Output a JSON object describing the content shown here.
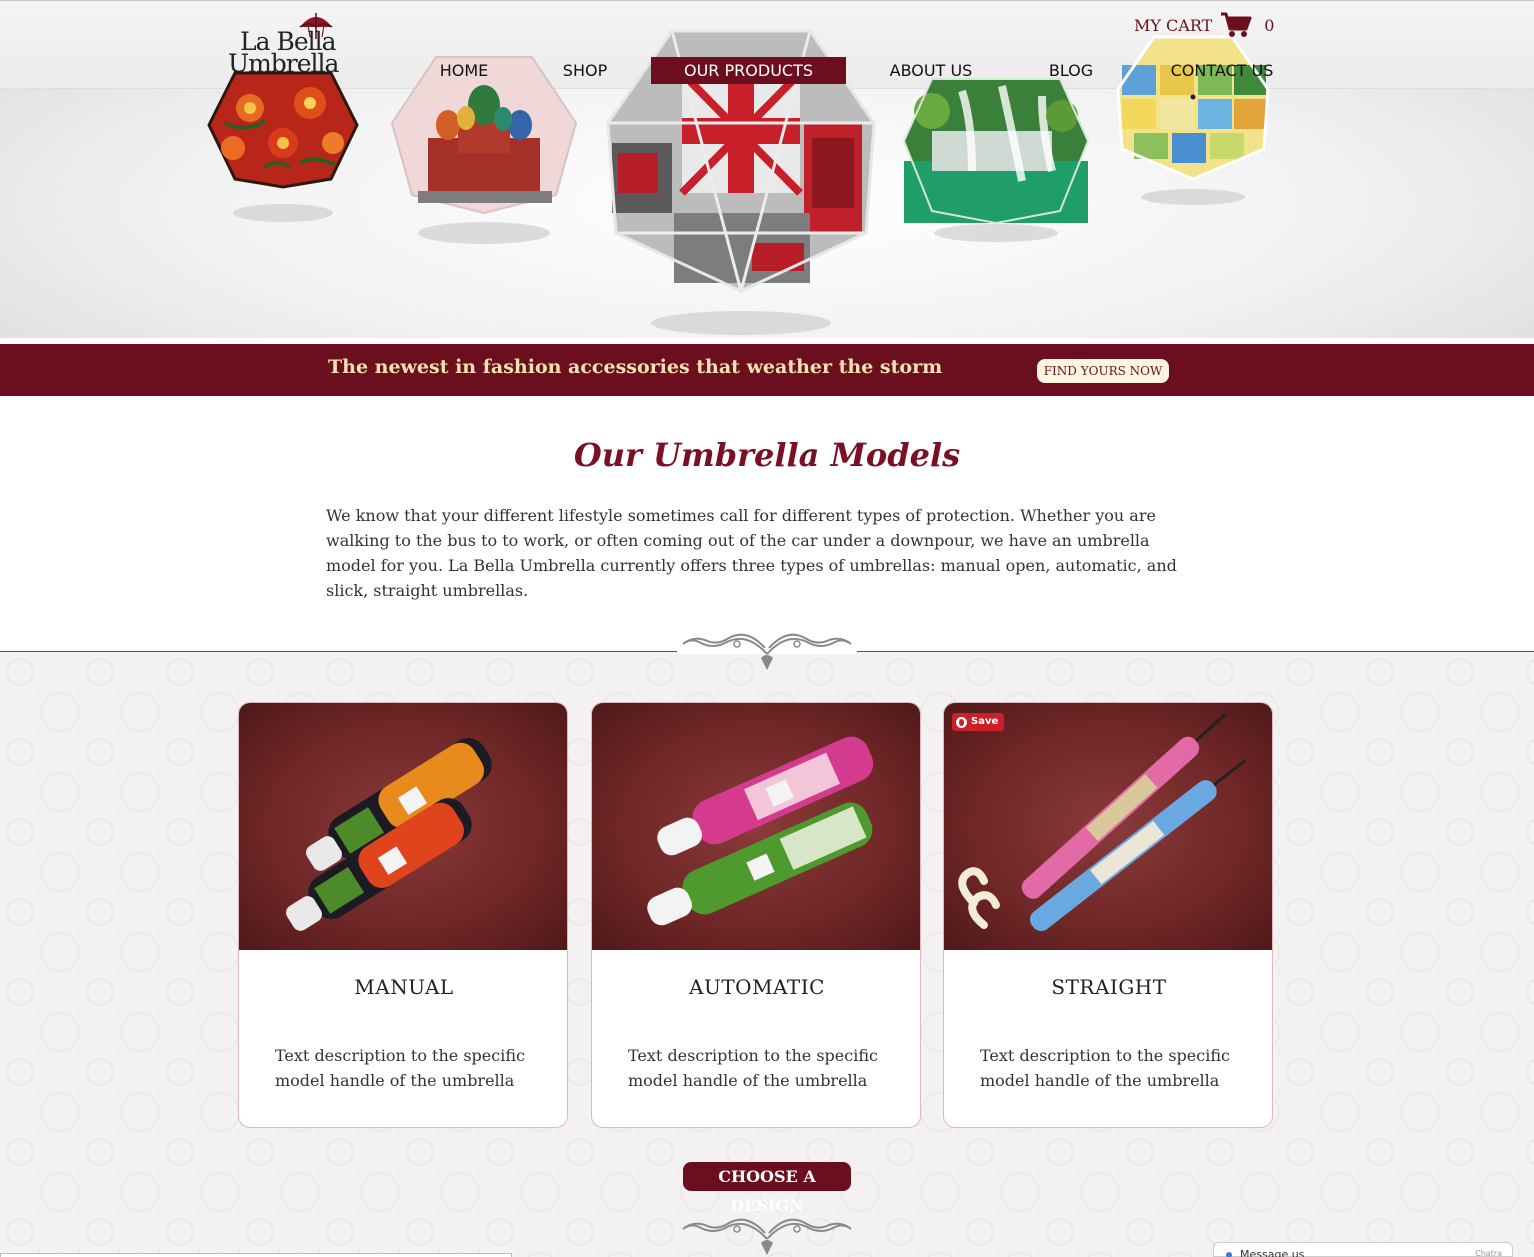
{
  "brand": {
    "logo_line1": "La Bella",
    "logo_line2": "Umbrella"
  },
  "cart": {
    "label": "MY CART",
    "count": "0",
    "icon": "shopping-cart-icon"
  },
  "nav": {
    "home": "HOME",
    "shop": "SHOP",
    "products": "OUR PRODUCTS",
    "about": "ABOUT US",
    "blog": "BLOG",
    "contact": "CONTACT US",
    "active": "OUR PRODUCTS"
  },
  "banner": {
    "tagline": "The newest in fashion accessories that weather the storm",
    "cta": "FIND YOURS NOW"
  },
  "models": {
    "title": "Our Umbrella Models",
    "intro": "We know that your different lifestyle sometimes call for different types of protection. Whether you are walking to the bus to to work, or often coming out of the car under a downpour, we have an umbrella model for you. La Bella Umbrella currently offers three types of umbrellas: manual open, automatic, and slick, straight umbrellas."
  },
  "cards": [
    {
      "title": "MANUAL",
      "desc": "Text description to the specific model handle of the umbrella"
    },
    {
      "title": "AUTOMATIC",
      "desc": "Text description to the specific model handle of the umbrella"
    },
    {
      "title": "STRAIGHT",
      "desc": "Text description to the specific model handle of the umbrella",
      "pin_label": "Save"
    }
  ],
  "cta": {
    "choose": "CHOOSE A DESIGN"
  },
  "chat": {
    "label": "Message us",
    "brand": "Chatra"
  },
  "colors": {
    "brand_red": "#6b0f1f",
    "banner_text": "#f4e3b0",
    "pinterest": "#cb2027"
  }
}
